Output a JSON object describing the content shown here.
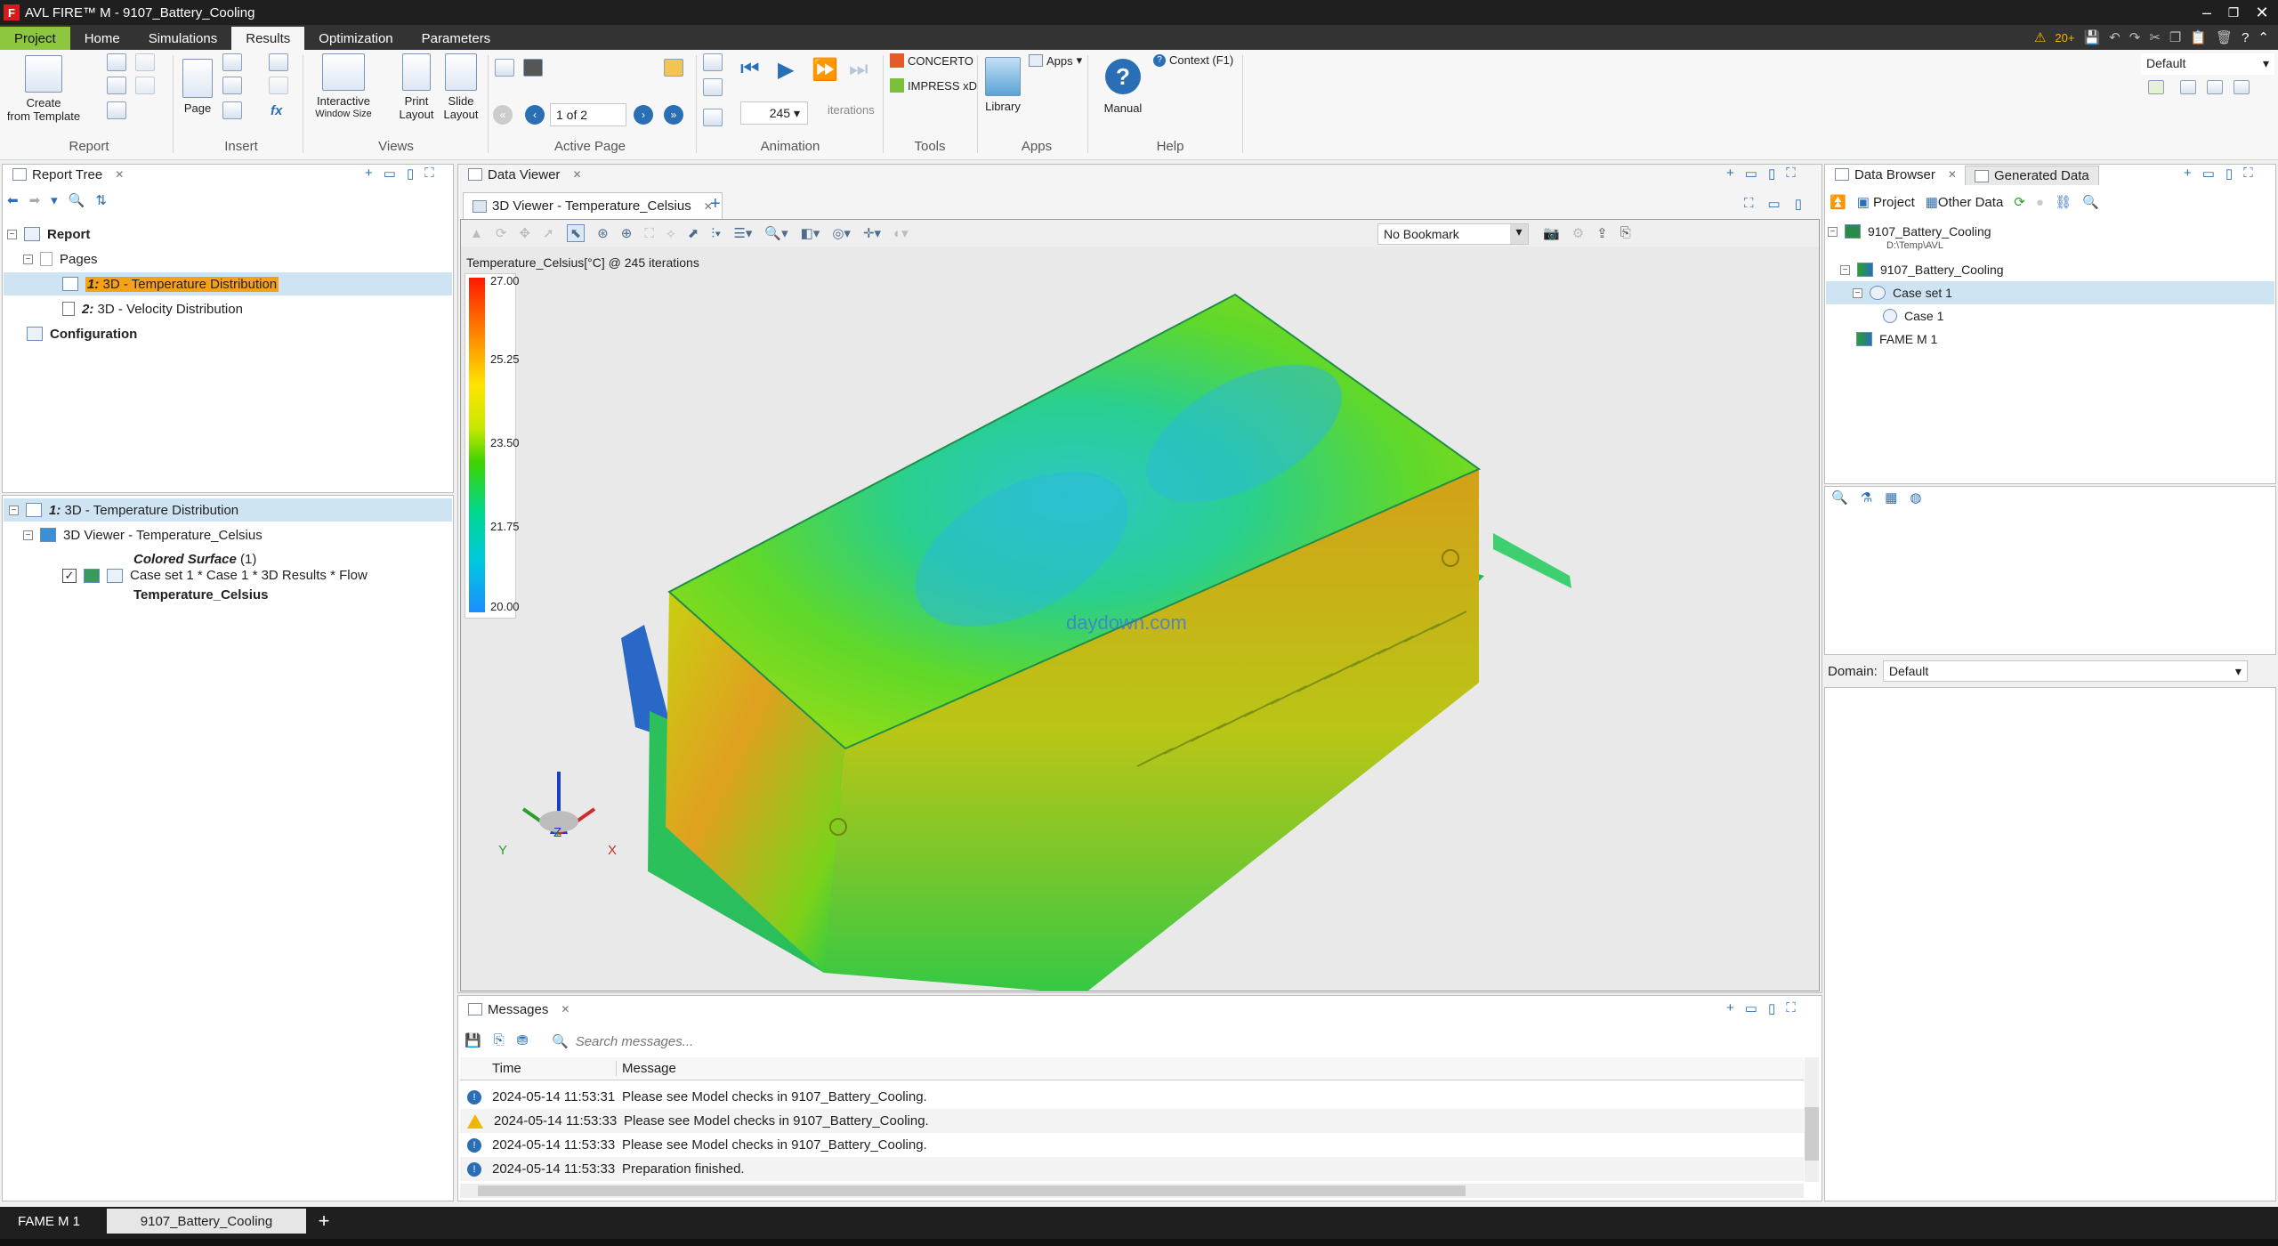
{
  "app": {
    "title": "AVL FIRE™ M - 9107_Battery_Cooling",
    "logo_letter": "F"
  },
  "menu": {
    "tabs": [
      "Project",
      "Home",
      "Simulations",
      "Results",
      "Optimization",
      "Parameters"
    ],
    "active_tab": "Results",
    "qat_warning": "20+",
    "layout_value": "Default"
  },
  "ribbon": {
    "groups": {
      "report": "Report",
      "insert": "Insert",
      "views": "Views",
      "active_page": "Active Page",
      "animation": "Animation",
      "tools": "Tools",
      "apps": "Apps",
      "help": "Help"
    },
    "create_from_template": "Create\nfrom Template",
    "page": "Page",
    "interactive": "Interactive",
    "window_size": "Window Size",
    "print_layout": "Print\nLayout",
    "slide_layout": "Slide\nLayout",
    "page_counter": "1 of 2",
    "iterations_value": "245",
    "iterations_label": "iterations",
    "concerto": "CONCERTO",
    "impress": "IMPRESS xD",
    "library": "Library",
    "apps_menu": "Apps",
    "manual": "Manual",
    "context": "Context (F1)"
  },
  "report_tree": {
    "tab": "Report Tree",
    "report": "Report",
    "pages": "Pages",
    "page1_num": "1:",
    "page1_label": "3D - Temperature Distribution",
    "page2_num": "2:",
    "page2_label": "3D - Velocity Distribution",
    "configuration": "Configuration"
  },
  "properties": {
    "page_num": "1:",
    "page_label": "3D - Temperature Distribution",
    "viewer": "3D Viewer - Temperature_Celsius",
    "colored_surface": "Colored Surface",
    "colored_count": "(1)",
    "case_path": "Case set 1 * Case 1 * 3D Results * Flow",
    "variable": "Temperature_Celsius"
  },
  "data_viewer": {
    "tab": "Data Viewer",
    "subtab": "3D Viewer - Temperature_Celsius",
    "bookmark": "No Bookmark",
    "legend_title": "Temperature_Celsius[°C] @ 245 iterations",
    "legend_ticks": [
      "27.00",
      "25.25",
      "23.50",
      "21.75",
      "20.00"
    ],
    "watermark": "daydown.com",
    "axis_x": "X",
    "axis_y": "Y",
    "axis_z": "Z"
  },
  "messages": {
    "tab": "Messages",
    "search_placeholder": "Search messages...",
    "col_time": "Time",
    "col_message": "Message",
    "rows": [
      {
        "type": "info",
        "time": "2024-05-14 11:53:31",
        "text": "Please see Model checks in 9107_Battery_Cooling."
      },
      {
        "type": "warn",
        "time": "2024-05-14 11:53:33",
        "text": "Please see Model checks in 9107_Battery_Cooling."
      },
      {
        "type": "info",
        "time": "2024-05-14 11:53:33",
        "text": "Please see Model checks in 9107_Battery_Cooling."
      },
      {
        "type": "info",
        "time": "2024-05-14 11:53:33",
        "text": "Preparation finished."
      }
    ]
  },
  "data_browser": {
    "tab": "Data Browser",
    "tab2": "Generated Data",
    "project_btn": "Project",
    "other_btn": "Other Data",
    "root": "9107_Battery_Cooling",
    "root_path": "D:\\Temp\\AVL",
    "child": "9107_Battery_Cooling",
    "caseset": "Case set 1",
    "case": "Case 1",
    "fame": "FAME M 1",
    "domain_label": "Domain:",
    "domain_value": "Default"
  },
  "bottom": {
    "tab1": "FAME M 1",
    "tab2": "9107_Battery_Cooling",
    "add": "+"
  },
  "colors": {
    "accent_green": "#8dc63f",
    "selection_orange": "#f7a11a",
    "selection_blue": "#cfe4f2",
    "info_blue": "#2a6fb5",
    "warn_yellow": "#f2b600"
  }
}
